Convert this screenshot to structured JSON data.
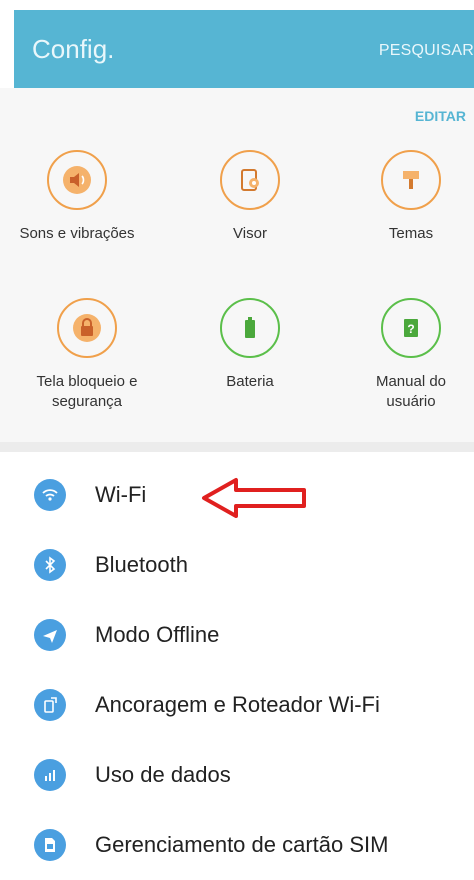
{
  "header": {
    "title": "Config.",
    "search_label": "PESQUISAR"
  },
  "edit_label": "EDITAR",
  "quick_settings": [
    {
      "label": "Sons e vibrações",
      "icon": "speaker-icon",
      "color": "#f0a04b"
    },
    {
      "label": "Visor",
      "icon": "display-icon",
      "color": "#f0a04b"
    },
    {
      "label": "Temas",
      "icon": "paintbrush-icon",
      "color": "#f0a04b"
    },
    {
      "label": "Tela bloqueio e\nsegurança",
      "icon": "lock-icon",
      "color": "#f0a04b"
    },
    {
      "label": "Bateria",
      "icon": "battery-icon",
      "color": "#5bbf4a"
    },
    {
      "label": "Manual do\nusuário",
      "icon": "manual-icon",
      "color": "#5bbf4a"
    }
  ],
  "settings_list": [
    {
      "label": "Wi-Fi",
      "icon": "wifi-icon"
    },
    {
      "label": "Bluetooth",
      "icon": "bluetooth-icon"
    },
    {
      "label": "Modo Offline",
      "icon": "airplane-icon"
    },
    {
      "label": "Ancoragem e Roteador Wi-Fi",
      "icon": "tethering-icon"
    },
    {
      "label": "Uso de dados",
      "icon": "data-usage-icon"
    },
    {
      "label": "Gerenciamento de cartão SIM",
      "icon": "sim-card-icon"
    }
  ],
  "colors": {
    "header": "#56b5d3",
    "accent": "#56b5d3",
    "list_icon": "#4a9fe0",
    "annotation_arrow": "#e0201f"
  }
}
